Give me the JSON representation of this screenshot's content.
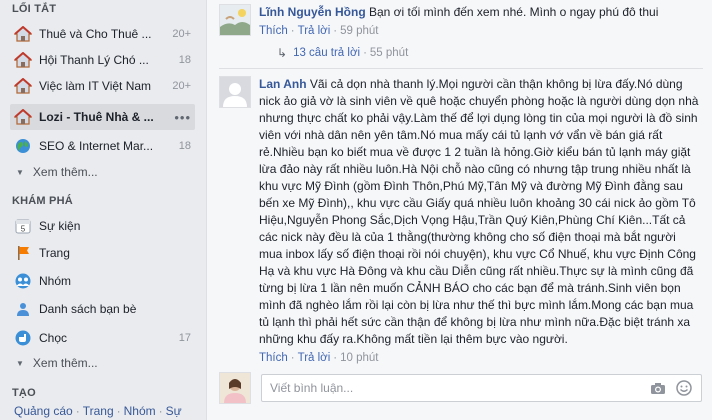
{
  "sidebar": {
    "shortcuts_title": "LỐI TẮT",
    "shortcuts": [
      {
        "label": "Thuê và Cho Thuê ...",
        "count": "20+",
        "icon": "house-icon"
      },
      {
        "label": "Hội Thanh Lý Chó ...",
        "count": "18",
        "icon": "house-icon"
      },
      {
        "label": "Việc làm IT Việt Nam",
        "count": "20+",
        "icon": "house-icon"
      },
      {
        "label": "Lozi - Thuê Nhà & ...",
        "more": "•••",
        "icon": "house-icon",
        "active": true
      },
      {
        "label": "SEO & Internet Mar...",
        "count": "18",
        "icon": "globe-icon"
      }
    ],
    "see_more": "Xem thêm...",
    "explore_title": "KHÁM PHÁ",
    "explore": [
      {
        "label": "Sự kiện",
        "icon": "calendar-icon"
      },
      {
        "label": "Trang",
        "icon": "flag-icon"
      },
      {
        "label": "Nhóm",
        "icon": "group-icon"
      },
      {
        "label": "Danh sách bạn bè",
        "icon": "friends-list-icon"
      },
      {
        "label": "Chọc",
        "count": "17",
        "icon": "poke-icon"
      }
    ],
    "see_more_2": "Xem thêm...",
    "create_title": "TẠO",
    "create_links": [
      "Quảng cáo",
      "Trang",
      "Nhóm",
      "Sự"
    ],
    "calendar_day": "5"
  },
  "comments": [
    {
      "author": "Lĩnh Nguyễn Hồng",
      "text": "Bạn ơi tối mình đến xem nhé. Mình o ngay phú đô thui",
      "like": "Thích",
      "reply": "Trả lời",
      "time": "59 phút"
    },
    {
      "author": "Lan Anh",
      "text": "Vãi cả dọn nhà thanh lý.Mọi người cần thận không bị lừa đấy.Nó dùng nick ảo giả vờ là sinh viên về quê hoặc chuyển phòng hoặc là người dùng dọn nhà nhưng thực chất ko phải vậy.Làm thế để lợi dụng lòng tin của mọi người là đồ sinh viên với nhà dân nên yên tâm.Nó mua mấy cái tủ lạnh vớ vẩn về bán giá rất rẻ.Nhiều bạn ko biết mua về được 1 2 tuần là hỏng.Giờ kiểu bán tủ lạnh máy giặt lừa đảo này rất nhiều luôn.Hà Nội chỗ nào cũng có nhưng tập trung nhiều nhất là khu vực Mỹ Đình (gồm Đình Thôn,Phú Mỹ,Tân Mỹ và đường Mỹ Đình đằng sau bến xe Mỹ Đình),, khu vực cầu Giấy quá nhiều luôn khoảng 30 cái nick ảo gồm Tô Hiệu,Nguyễn Phong Sắc,Dịch Vọng Hậu,Trần Quý Kiên,Phùng Chí Kiên...Tất cả các nick này đều là của 1 thằng(thường không cho số điện thoại mà bắt người mua inbox lấy số điện thoại rồi nói chuyện), khu vực Cổ Nhuế, khu vực Định Công Hạ và khu vực Hà Đông và khu cầu Diễn cũng rất nhiều.Thực sự là mình cũng đã từng bị lừa 1 lần nên muốn CẢNH BÁO cho các bạn để mà tránh.Sinh viên bọn mình đã nghèo lắm rồi lại còn bị lừa như thế thì bực mình lắm.Mong các bạn mua tủ lạnh thì phải hết sức cần thận để không bị lừa như mình nữa.Đặc biệt tránh xa những khu đấy ra.Không mất tiền lại thêm bực vào người.",
      "like": "Thích",
      "reply": "Trả lời",
      "time": "10 phút"
    }
  ],
  "replies": {
    "label": "13 câu trả lời",
    "time": "55 phút"
  },
  "composer": {
    "placeholder": "Viết bình luận..."
  },
  "colors": {
    "link": "#365899",
    "sidebar_bg": "#e9ebee",
    "feed_bg": "#f6f7f9"
  }
}
